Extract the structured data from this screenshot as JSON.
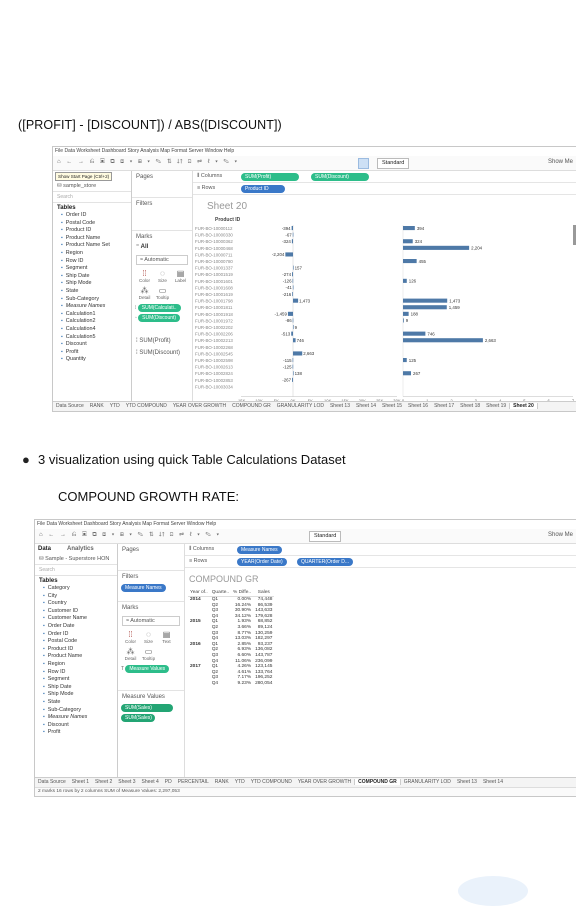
{
  "formula_text": "([PROFIT] - [DISCOUNT]) / ABS([DISCOUNT])",
  "bullet_text": "3 visualization using quick Table Calculations Dataset",
  "subheading": "COMPOUND GROWTH RATE:",
  "shot1": {
    "menu": "File  Data  Worksheet  Dashboard  Story  Analysis  Map  Format  Server  Window  Help",
    "tooltip": "Show Start Page (Ctrl+2)",
    "datasource": "sample_store",
    "search_placeholder": "Search",
    "tables_label": "Tables",
    "fields": [
      "Order ID",
      "Postal Code",
      "Product ID",
      "Product Name",
      "Product Name Set",
      "Region",
      "Row ID",
      "Segment",
      "Ship Date",
      "Ship Mode",
      "State",
      "Sub-Category",
      "Measure Names",
      "Calculation1",
      "Calculation2",
      "Calculation4",
      "Calculation5",
      "Discount",
      "Profit",
      "Quantity"
    ],
    "pages_label": "Pages",
    "filters_label": "Filters",
    "marks_label": "Marks",
    "marks_all": "All",
    "marks_type": "Automatic",
    "mark_buttons": [
      "Color",
      "Size",
      "Label",
      "Detail",
      "Tooltip"
    ],
    "marks_pills": [
      "SUM(Calculati..",
      "SUM(Discount)"
    ],
    "measure_cards": [
      "SUM(Profit)",
      "SUM(Discount)"
    ],
    "columns_label": "Columns",
    "rows_label": "Rows",
    "columns_pills": [
      "SUM(Profit)",
      "SUM(Discount)"
    ],
    "rows_pills": [
      "Product ID"
    ],
    "fit": "Standard",
    "show_me": "Show Me",
    "sheet_title": "Sheet 20",
    "product_id_header": "Product ID",
    "product_ids": [
      "FUR-BO-10000112",
      "FUR-BO-10000330",
      "FUR-BO-10000362",
      "FUR-BO-10000468",
      "FUR-BO-10000711",
      "FUR-BO-10000780",
      "FUR-BO-10001337",
      "FUR-BO-10001519",
      "FUR-BO-10001601",
      "FUR-BO-10001608",
      "FUR-BO-10001619",
      "FUR-BO-10001798",
      "FUR-BO-10001811",
      "FUR-BO-10001918",
      "FUR-BO-10001972",
      "FUR-BO-10002202",
      "FUR-BO-10002206",
      "FUR-BO-10002213",
      "FUR-BO-10002268",
      "FUR-BO-10002545",
      "FUR-BO-10002598",
      "FUR-BO-10002613",
      "FUR-BO-10002824",
      "FUR-BO-10002853",
      "FUR-BO-10003034"
    ],
    "profit_axis_label": "Profit",
    "discount_axis_label": "Discount",
    "profit_ticks": [
      "-15K",
      "-10K",
      "-5K",
      "0K",
      "5K",
      "10K",
      "15K",
      "20K",
      "25K",
      "30K"
    ],
    "discount_ticks": [
      "0",
      "1",
      "2",
      "3",
      "4",
      "5",
      "6",
      "7"
    ],
    "tabs": [
      "Data Source",
      "RANK",
      "YTD",
      "YTD COMPOUND",
      "YEAR OVER GROWTH",
      "COMPOUND GR",
      "GRANULARITY LOD",
      "Sheet 13",
      "Sheet 14",
      "Sheet 15",
      "Sheet 16",
      "Sheet 17",
      "Sheet 18",
      "Sheet 19",
      "Sheet 20"
    ],
    "active_tab": "Sheet 20"
  },
  "chart_data": [
    {
      "type": "bar",
      "title": "",
      "xlabel": "Profit",
      "ylabel": "Product ID",
      "categories": [
        "r1",
        "r2",
        "r3",
        "r4",
        "r5",
        "r6",
        "r7",
        "r8",
        "r9",
        "r10",
        "r11",
        "r12",
        "r13",
        "r14",
        "r15",
        "r16",
        "r17",
        "r18",
        "r19",
        "r20",
        "r21",
        "r22",
        "r23",
        "r24",
        "r25",
        "r26"
      ],
      "values": [
        -394,
        -67,
        -324,
        null,
        -2204,
        null,
        157,
        -274,
        -126,
        -41,
        -216,
        1473,
        null,
        -1459,
        -86,
        9,
        -513,
        746,
        null,
        2663,
        -115,
        -125,
        138,
        -267,
        null,
        null
      ],
      "labels": [
        "-394",
        "-67",
        "-324",
        "",
        "-2,204",
        "",
        "157",
        "-274",
        "-126",
        "-41",
        "-216",
        "1,473",
        "",
        "-1,459",
        "-86",
        "9",
        "-513",
        "746",
        "",
        "2,663",
        "-115",
        "-125",
        "138",
        "-267",
        "",
        ""
      ],
      "xlim": [
        -15000,
        30000
      ]
    },
    {
      "type": "bar",
      "title": "",
      "xlabel": "Discount",
      "ylabel": "Product ID",
      "categories": [
        "r1",
        "r2",
        "r3",
        "r4",
        "r5",
        "r6",
        "r7",
        "r8",
        "r9",
        "r10",
        "r11",
        "r12",
        "r13",
        "r14",
        "r15",
        "r16",
        "r17",
        "r18",
        "r19",
        "r20",
        "r21",
        "r22",
        "r23",
        "r24",
        "r25",
        "r26"
      ],
      "values": [
        394,
        null,
        324,
        2204,
        null,
        455,
        null,
        null,
        126,
        null,
        null,
        1473,
        1459,
        188,
        9,
        null,
        746,
        2663,
        null,
        null,
        125,
        null,
        267,
        null,
        null,
        null
      ],
      "labels": [
        "394",
        "",
        "324",
        "2,204",
        "",
        "455",
        "",
        "",
        "126",
        "",
        "",
        "1,473",
        "1,459",
        "188",
        "9",
        "",
        "746",
        "2,663",
        "",
        "",
        "125",
        "",
        "267",
        "",
        "",
        ""
      ],
      "xlim": [
        0,
        7
      ]
    }
  ],
  "shot2": {
    "menu": "File  Data  Worksheet  Dashboard  Story  Analysis  Map  Format  Server  Window  Help",
    "data_tab": "Data",
    "analytics_tab": "Analytics",
    "datasource": "Sample - Superstore HON",
    "search_placeholder": "Search",
    "tables_label": "Tables",
    "fields": [
      "Category",
      "City",
      "Country",
      "Customer ID",
      "Customer Name",
      "Order Date",
      "Order ID",
      "Postal Code",
      "Product ID",
      "Product Name",
      "Region",
      "Row ID",
      "Segment",
      "Ship Date",
      "Ship Mode",
      "State",
      "Sub-Category",
      "Measure Names",
      "Discount",
      "Profit"
    ],
    "pages_label": "Pages",
    "filters_label": "Filters",
    "filter_pill": "Measure Names",
    "marks_label": "Marks",
    "marks_type": "Automatic",
    "mark_buttons": [
      "Color",
      "Size",
      "Text",
      "Detail",
      "Tooltip"
    ],
    "marks_pill": "Measure Values",
    "measure_values_label": "Measure Values",
    "measure_values_pills": [
      "SUM(Sales)",
      "SUM(Sales)"
    ],
    "columns_label": "Columns",
    "rows_label": "Rows",
    "columns_pill": "Measure Names",
    "rows_pills": [
      "YEAR(Order Date)",
      "QUARTER(Order D..."
    ],
    "fit": "Standard",
    "show_me": "Show Me",
    "sheet_title": "COMPOUND GR",
    "table": {
      "headers": [
        "Year of..",
        "Quarte..",
        "% Diffe..",
        "Sales"
      ],
      "rows": [
        [
          "2014",
          "Q1",
          "0.00%",
          "74,448"
        ],
        [
          "",
          "Q2",
          "16.24%",
          "86,539"
        ],
        [
          "",
          "Q3",
          "30.90%",
          "143,633"
        ],
        [
          "",
          "Q4",
          "34.12%",
          "179,628"
        ],
        [
          "2015",
          "Q1",
          "1.93%",
          "68,852"
        ],
        [
          "",
          "Q2",
          "3.66%",
          "89,124"
        ],
        [
          "",
          "Q3",
          "8.77%",
          "130,259"
        ],
        [
          "",
          "Q4",
          "13.03%",
          "182,297"
        ],
        [
          "2016",
          "Q1",
          "2.85%",
          "93,237"
        ],
        [
          "",
          "Q2",
          "6.93%",
          "136,082"
        ],
        [
          "",
          "Q3",
          "6.60%",
          "143,787"
        ],
        [
          "",
          "Q4",
          "11.06%",
          "236,099"
        ],
        [
          "2017",
          "Q1",
          "4.26%",
          "123,145"
        ],
        [
          "",
          "Q2",
          "4.61%",
          "133,764"
        ],
        [
          "",
          "Q3",
          "7.17%",
          "196,252"
        ],
        [
          "",
          "Q4",
          "9.23%",
          "280,054"
        ]
      ]
    },
    "tabs": [
      "Data Source",
      "Sheet 1",
      "Sheet 2",
      "Sheet 3",
      "Sheet 4",
      "PD",
      "PERCENTAIL",
      "RANK",
      "YTD",
      "YTD COMPOUND",
      "YEAR OVER GROWTH",
      "COMPOUND GR",
      "GRANULARITY LOD",
      "Sheet 13",
      "Sheet 14"
    ],
    "active_tab": "COMPOUND GR",
    "status": "2 marks   16 rows by 2 columns   SUM of Measure Values: 2,297,053"
  }
}
